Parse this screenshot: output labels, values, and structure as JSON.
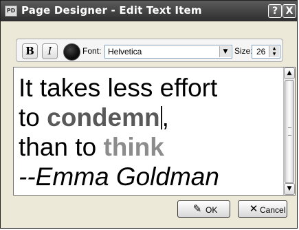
{
  "window": {
    "title": "Page Designer - Edit Text Item",
    "help": "?",
    "close": "X",
    "icon_text": "PD"
  },
  "toolbar": {
    "bold": "B",
    "italic": "I",
    "font_label": "Font:",
    "font_value": "Helvetica",
    "size_label": "Size:",
    "size_value": "26",
    "text_color": "#000000"
  },
  "editor": {
    "lines": [
      {
        "text": "It takes less effort"
      },
      {
        "prefix": "to ",
        "emph": "condemn",
        "suffix": ","
      },
      {
        "prefix": "than to ",
        "emph": "think"
      },
      {
        "text": "--Emma Goldman"
      }
    ]
  },
  "buttons": {
    "ok": "OK",
    "cancel": "Cancel"
  }
}
